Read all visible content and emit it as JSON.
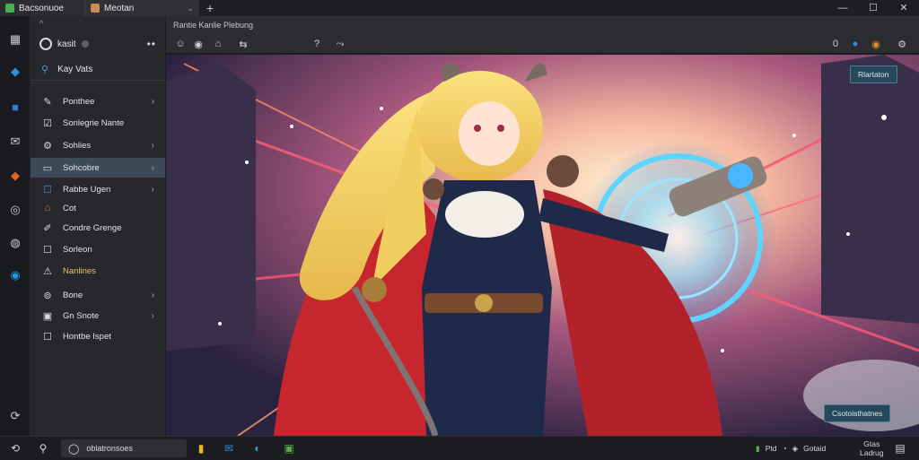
{
  "tabs": [
    {
      "label": "Bacsonuoe",
      "favicon_color": "#4caf50"
    },
    {
      "label": "Meotan",
      "favicon_color": "#c98c52",
      "close": "⌄"
    }
  ],
  "new_tab": "+",
  "window_controls": {
    "minimize": "—",
    "maximize": "☐",
    "close": "✕"
  },
  "sidebar": {
    "top_caret": "^",
    "account_name": "kasit",
    "more": "••",
    "search_label": "Kay Vats",
    "items": [
      {
        "icon": "pin-icon",
        "glyph": "✎",
        "label": "Ponthee",
        "chevron": "›"
      },
      {
        "icon": "edit-icon",
        "glyph": "☑",
        "label": "Sonlegrie Nante",
        "chevron": ""
      },
      {
        "icon": "settings-icon",
        "glyph": "⚙",
        "label": "Sohlies",
        "chevron": "›"
      },
      {
        "icon": "folder-icon",
        "glyph": "▭",
        "label": "Sohcobre",
        "chevron": "›",
        "active": true
      },
      {
        "icon": "box-icon",
        "glyph": "☐",
        "label": "Rabbe Ugen",
        "chevron": "›"
      },
      {
        "icon": "tag-icon",
        "glyph": "⌂",
        "label": "Cot",
        "chevron": ""
      },
      {
        "icon": "brush-icon",
        "glyph": "✐",
        "label": "Condre Grenge",
        "chevron": ""
      },
      {
        "icon": "square-icon",
        "glyph": "☐",
        "label": "Sorleon",
        "chevron": ""
      },
      {
        "icon": "warning-icon",
        "glyph": "⚠",
        "label": "Nanlines",
        "chevron": ""
      },
      {
        "icon": "globe-icon",
        "glyph": "⊚",
        "label": "Bone",
        "chevron": "›"
      },
      {
        "icon": "image-icon",
        "glyph": "▣",
        "label": "Gn Snote",
        "chevron": "›"
      },
      {
        "icon": "checkbox-icon",
        "glyph": "☐",
        "label": "Hontbe Ispet",
        "chevron": ""
      }
    ]
  },
  "toolbar": {
    "breadcrumb": "Rantie  Kanlie  Plebung",
    "left_icons": [
      "☺",
      "◉",
      "⌂",
      "⇆"
    ],
    "mid_icons": [
      "?",
      "⤳"
    ],
    "right_icons": [
      "0",
      "●",
      "◉",
      "⚙"
    ]
  },
  "content": {
    "badge_top": "Rlartaton",
    "badge_bottom": "Csotoisthatnes"
  },
  "taskbar": {
    "search_label": "oblatronsoes",
    "tray_text": "Ptd",
    "tray_label": "Gotaid",
    "clock_line1": "Gtas",
    "clock_line2": "Ladrug"
  },
  "rail_icons": [
    {
      "name": "grid-icon",
      "glyph": "▦",
      "color": "#c8cbd0"
    },
    {
      "name": "bird-icon",
      "glyph": "◆",
      "color": "#2f8fe0"
    },
    {
      "name": "store-icon",
      "glyph": "■",
      "color": "#2b7fd8"
    },
    {
      "name": "mail-icon",
      "glyph": "✉",
      "color": "#c8cbd0"
    },
    {
      "name": "fox-icon",
      "glyph": "◆",
      "color": "#e0662a"
    },
    {
      "name": "camera-icon",
      "glyph": "◎",
      "color": "#c8cbd0"
    },
    {
      "name": "power-icon",
      "glyph": "◍",
      "color": "#c8cbd0"
    },
    {
      "name": "circle-icon",
      "glyph": "◉",
      "color": "#1e9be8"
    },
    {
      "name": "refresh-icon",
      "glyph": "⟳",
      "color": "#c8cbd0"
    }
  ],
  "taskbar_apps": [
    {
      "name": "folder-app-icon",
      "glyph": "▮",
      "color": "#e8b92a"
    },
    {
      "name": "mail-app-icon",
      "glyph": "✉",
      "color": "#2f8fe0"
    },
    {
      "name": "edge-app-icon",
      "glyph": "◐",
      "color": "#2aa3e0"
    },
    {
      "name": "store-app-icon",
      "glyph": "▣",
      "color": "#55b043"
    }
  ]
}
